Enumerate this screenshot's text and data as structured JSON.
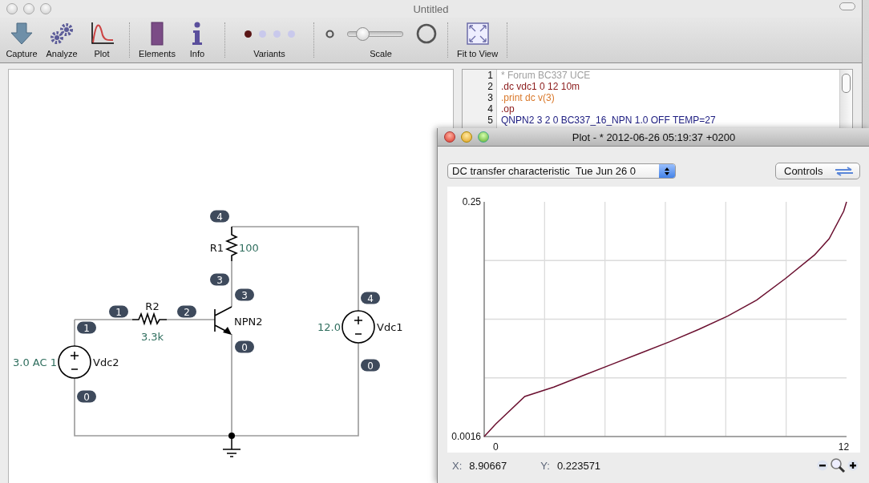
{
  "window": {
    "title": "Untitled"
  },
  "toolbar": [
    {
      "kind": "button",
      "label": "Capture"
    },
    {
      "kind": "button",
      "label": "Analyze"
    },
    {
      "kind": "button",
      "label": "Plot"
    },
    {
      "kind": "separator"
    },
    {
      "kind": "button",
      "label": "Elements"
    },
    {
      "kind": "button",
      "label": "Info"
    },
    {
      "kind": "separator"
    },
    {
      "kind": "variants",
      "label": "Variants",
      "options": [
        {
          "selected": true
        },
        {
          "selected": false
        },
        {
          "selected": false
        },
        {
          "selected": false
        }
      ]
    },
    {
      "kind": "separator"
    },
    {
      "kind": "scale",
      "label": "Scale",
      "level": 0.28
    },
    {
      "kind": "separator"
    },
    {
      "kind": "button",
      "label": "Fit to View"
    },
    {
      "kind": "separator"
    }
  ],
  "schematic": {
    "components": [
      {
        "kind": "resistor",
        "name": "R1",
        "value": "100"
      },
      {
        "kind": "resistor",
        "name": "R2",
        "value": "3.3k"
      },
      {
        "kind": "npn",
        "name": "NPN2"
      },
      {
        "kind": "source",
        "name": "Vdc2",
        "value": "3.0 AC 1"
      },
      {
        "kind": "source",
        "name": "Vdc1",
        "value": "12.0"
      },
      {
        "kind": "ground"
      }
    ],
    "node_labels": [
      "4",
      "3",
      "3",
      "4",
      "1",
      "2",
      "1",
      "0",
      "0",
      "0"
    ]
  },
  "netlist": {
    "lines": [
      {
        "number": "1",
        "text": "* Forum BC337 UCE",
        "color": "#a0a0a0"
      },
      {
        "number": "2",
        "text": ".dc vdc1 0 12 10m",
        "color": "#8b1a1a"
      },
      {
        "number": "3",
        "text": ".print dc v(3)",
        "color": "#d9782a"
      },
      {
        "number": "4",
        "text": ".op",
        "color": "#8b1a1a"
      },
      {
        "number": "5",
        "text": "QNPN2 3 2 0 BC337_16_NPN 1.0 OFF TEMP=27",
        "color": "#1c1c80"
      }
    ]
  },
  "plot_window": {
    "title": "Plot - * 2012-06-26 05:19:37 +0200",
    "dataset_select": {
      "value": "DC transfer characteristic  Tue Jun 26 0"
    },
    "controls_button": "Controls",
    "chart_data": {
      "type": "line",
      "x": [
        -0.4,
        0,
        1,
        2,
        3,
        4,
        5,
        6,
        7,
        8,
        9,
        10,
        11,
        11.5,
        12,
        12.1
      ],
      "series": [
        {
          "color": "#6b1030",
          "values": [
            0.0016,
            0.015,
            0.044,
            0.054,
            0.066,
            0.078,
            0.09,
            0.102,
            0.115,
            0.129,
            0.146,
            0.169,
            0.194,
            0.211,
            0.24,
            0.25
          ]
        }
      ],
      "xlim": [
        -0.4,
        12.1
      ],
      "ylim": [
        0.0016,
        0.25
      ],
      "xticks": [
        0,
        12
      ],
      "yticks": [
        0.0016,
        0.25
      ]
    },
    "readout": {
      "x_label": "X:",
      "x_value": "8.90667",
      "y_label": "Y:",
      "y_value": "0.223571"
    }
  }
}
